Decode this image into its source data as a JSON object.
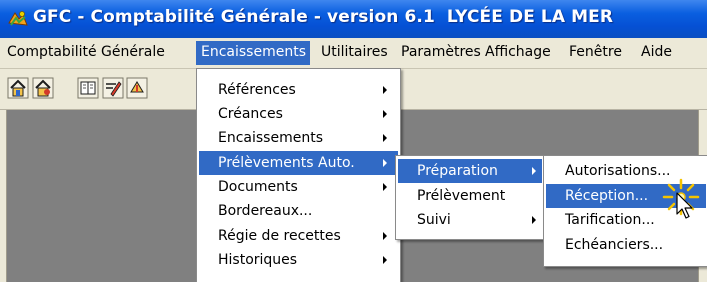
{
  "window": {
    "title_app": "GFC - Comptabilité Générale - version 6.1",
    "title_org": "LYCÉE DE LA MER",
    "icon": "gfc-app-icon"
  },
  "menubar": {
    "items": [
      {
        "label": "Comptabilité Générale"
      },
      {
        "label": "Encaissements",
        "active": true
      },
      {
        "label": "Utilitaires"
      },
      {
        "label": "Paramètres"
      },
      {
        "label": "Affichage"
      },
      {
        "label": "Fenêtre"
      },
      {
        "label": "Aide"
      }
    ]
  },
  "toolbar": {
    "icons": [
      "home-icon",
      "home-users-icon",
      "book-icon",
      "edit-icon",
      "transfer-icon"
    ]
  },
  "menus": {
    "encaissements": {
      "items": [
        {
          "label": "Références",
          "submenu": true
        },
        {
          "label": "Créances",
          "submenu": true
        },
        {
          "label": "Encaissements",
          "submenu": true
        },
        {
          "label": "Prélèvements Auto.",
          "submenu": true,
          "highlighted": true
        },
        {
          "label": "Documents",
          "submenu": true
        },
        {
          "label": "Bordereaux...",
          "submenu": false
        },
        {
          "label": "Régie de recettes",
          "submenu": true
        },
        {
          "label": "Historiques",
          "submenu": true
        }
      ]
    },
    "prelevements": {
      "items": [
        {
          "label": "Préparation",
          "submenu": true,
          "highlighted": true
        },
        {
          "label": "Prélèvement",
          "submenu": false
        },
        {
          "label": "Suivi",
          "submenu": true
        }
      ]
    },
    "preparation": {
      "items": [
        {
          "label": "Autorisations...",
          "highlighted": false
        },
        {
          "label": "Réception...",
          "highlighted": true
        },
        {
          "label": "Tarification...",
          "highlighted": false
        },
        {
          "label": "Echéanciers...",
          "highlighted": false
        }
      ]
    }
  },
  "colors": {
    "titlebar": "#0a5fe0",
    "menu_highlight": "#316ac5",
    "menubar_bg": "#ece9d8",
    "workspace": "#808080",
    "cursor_burst": "#f5c400"
  }
}
